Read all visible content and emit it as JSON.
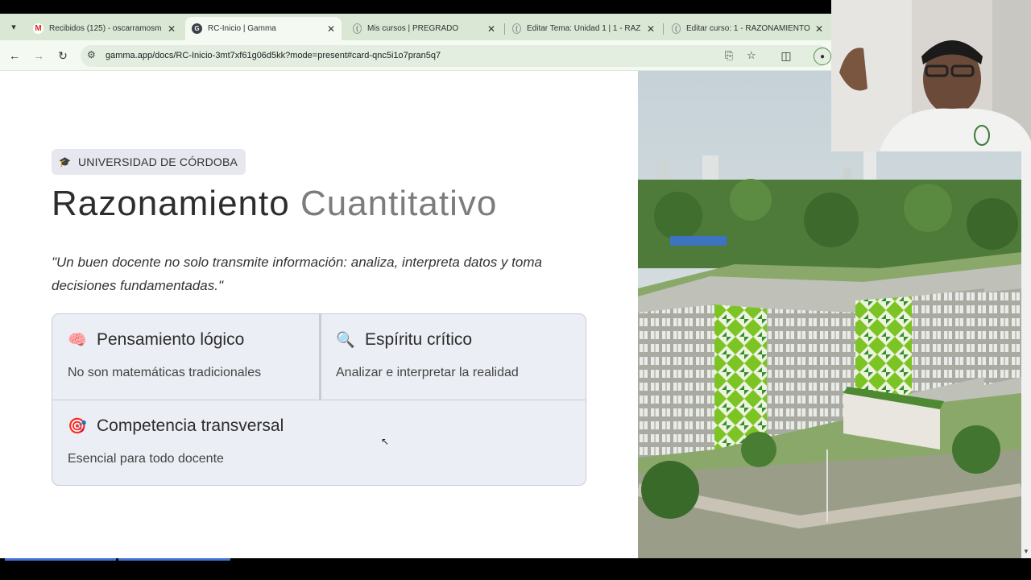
{
  "browser": {
    "tabs": [
      {
        "title": "Recibidos (125) - oscarramosm",
        "favicon": "gmail-icon",
        "active": false
      },
      {
        "title": "RC-Inicio | Gamma",
        "favicon": "gamma-icon",
        "active": true
      },
      {
        "title": "Mis cursos | PREGRADO",
        "favicon": "moodle-icon",
        "active": false
      },
      {
        "title": "Editar Tema: Unidad 1 | 1 - RAZ",
        "favicon": "moodle-icon",
        "active": false
      },
      {
        "title": "Editar curso: 1 - RAZONAMIENTO",
        "favicon": "moodle-icon",
        "active": false
      }
    ],
    "url": "gamma.app/docs/RC-Inicio-3mt7xf61g06d5kk?mode=present#card-qnc5i1o7pran5q7"
  },
  "slide": {
    "badge": "UNIVERSIDAD DE CÓRDOBA",
    "title_part1": "Razonamiento",
    "title_part2": "Cuantitativo",
    "quote": "\"Un buen docente no solo transmite información: analiza, interpreta datos y toma decisiones fundamentadas.\"",
    "cards": [
      {
        "icon": "brain-icon",
        "emoji": "🧠",
        "title": "Pensamiento lógico",
        "text": "No son matemáticas tradicionales"
      },
      {
        "icon": "magnifier-icon",
        "emoji": "🔍",
        "title": "Espíritu crítico",
        "text": "Analizar e interpretar la realidad"
      },
      {
        "icon": "target-icon",
        "emoji": "🎯",
        "title": "Competencia transversal",
        "text": "Esencial para todo docente"
      }
    ]
  },
  "colors": {
    "tabstrip": "#d9e7d4",
    "toolbar": "#f4faf2",
    "card_bg": "#eceef5",
    "title_dark": "#2d2d2d",
    "title_light": "#7c7c7c",
    "progress": "#3f6fd8"
  }
}
